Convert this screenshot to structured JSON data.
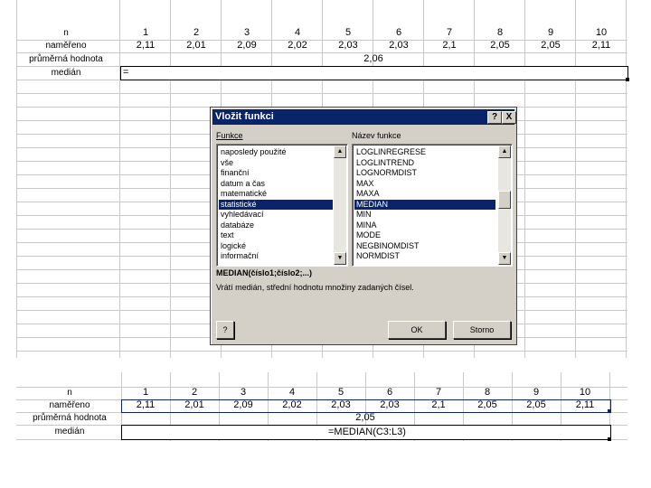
{
  "top_table": {
    "row_labels": [
      "n",
      "naměřeno",
      "průměrná hodnota",
      "medián"
    ],
    "n_values": [
      "1",
      "2",
      "3",
      "4",
      "5",
      "6",
      "7",
      "8",
      "9",
      "10"
    ],
    "measured": [
      "2,11",
      "2,01",
      "2,09",
      "2,02",
      "2,03",
      "2,03",
      "2,1",
      "2,05",
      "2,05",
      "2,11"
    ],
    "average": "2,06",
    "median_input": "="
  },
  "dialog": {
    "title": "Vložit funkci",
    "help_btn": "?",
    "close_btn": "X",
    "category_label": "Funkce",
    "name_label": "Název funkce",
    "categories": [
      "naposledy použité",
      "vše",
      "finanční",
      "datum a čas",
      "matematické",
      "statistické",
      "vyhledávací",
      "databáze",
      "text",
      "logické",
      "informační"
    ],
    "selected_category": "statistické",
    "functions": [
      "LOGLINREGRESE",
      "LOGLINTREND",
      "LOGNORMDIST",
      "MAX",
      "MAXA",
      "MEDIAN",
      "MIN",
      "MINA",
      "MODE",
      "NEGBINOMDIST",
      "NORMDIST"
    ],
    "selected_function": "MEDIAN",
    "syntax": "MEDIAN(číslo1;číslo2;...)",
    "description": "Vrátí medián, střední hodnotu množiny zadaných čísel.",
    "ok_label": "OK",
    "cancel_label": "Storno",
    "help_icon_label": "?"
  },
  "bottom_table": {
    "row_labels": [
      "n",
      "naměřeno",
      "průměrná hodnota",
      "medián"
    ],
    "n_values": [
      "1",
      "2",
      "3",
      "4",
      "5",
      "6",
      "7",
      "8",
      "9",
      "10"
    ],
    "measured": [
      "2,11",
      "2,01",
      "2,09",
      "2,02",
      "2,03",
      "2,03",
      "2,1",
      "2,05",
      "2,05",
      "2,11"
    ],
    "average": "2,05",
    "median_formula": "=MEDIAN(C3:L3)"
  },
  "colors": {
    "title_bar": "#0a246a",
    "selection": "#0a246a",
    "dialog_face": "#d4d0c8",
    "grid": "#c8c8c8"
  }
}
